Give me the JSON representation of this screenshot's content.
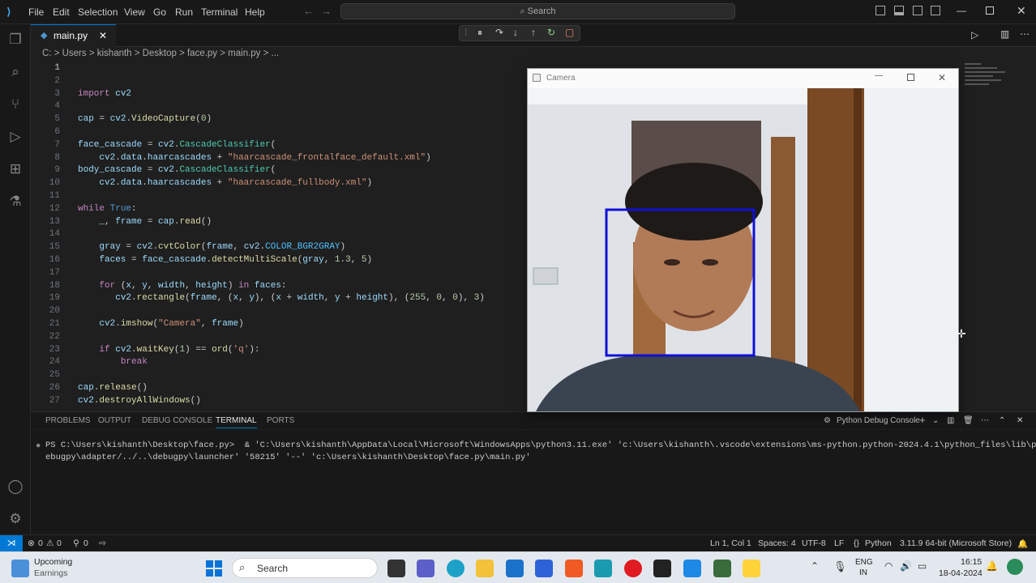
{
  "menu": [
    "File",
    "Edit",
    "Selection",
    "View",
    "Go",
    "Run",
    "Terminal",
    "Help"
  ],
  "search": {
    "label": "Search"
  },
  "tab": {
    "filename": "main.py"
  },
  "breadcrumb": "C: > Users > kishanth > Desktop > face.py > main.py > ...",
  "code": [
    {
      "n": "1",
      "t": ""
    },
    {
      "n": "2",
      "t": ""
    },
    {
      "n": "3",
      "t": "import cv2"
    },
    {
      "n": "4",
      "t": ""
    },
    {
      "n": "5",
      "t": "cap = cv2.VideoCapture(0)"
    },
    {
      "n": "6",
      "t": ""
    },
    {
      "n": "7",
      "t": "face_cascade = cv2.CascadeClassifier("
    },
    {
      "n": "8",
      "t": "    cv2.data.haarcascades + \"haarcascade_frontalface_default.xml\")"
    },
    {
      "n": "9",
      "t": "body_cascade = cv2.CascadeClassifier("
    },
    {
      "n": "10",
      "t": "    cv2.data.haarcascades + \"haarcascade_fullbody.xml\")"
    },
    {
      "n": "11",
      "t": ""
    },
    {
      "n": "12",
      "t": "while True:"
    },
    {
      "n": "13",
      "t": "    _, frame = cap.read()"
    },
    {
      "n": "14",
      "t": ""
    },
    {
      "n": "15",
      "t": "    gray = cv2.cvtColor(frame, cv2.COLOR_BGR2GRAY)"
    },
    {
      "n": "16",
      "t": "    faces = face_cascade.detectMultiScale(gray, 1.3, 5)"
    },
    {
      "n": "17",
      "t": ""
    },
    {
      "n": "18",
      "t": "    for (x, y, width, height) in faces:"
    },
    {
      "n": "19",
      "t": "       cv2.rectangle(frame, (x, y), (x + width, y + height), (255, 0, 0), 3)"
    },
    {
      "n": "20",
      "t": ""
    },
    {
      "n": "21",
      "t": "    cv2.imshow(\"Camera\", frame)"
    },
    {
      "n": "22",
      "t": ""
    },
    {
      "n": "23",
      "t": "    if cv2.waitKey(1) == ord('q'):"
    },
    {
      "n": "24",
      "t": "        break"
    },
    {
      "n": "25",
      "t": ""
    },
    {
      "n": "26",
      "t": "cap.release()"
    },
    {
      "n": "27",
      "t": "cv2.destroyAllWindows()"
    }
  ],
  "panel": {
    "tabs": [
      "PROBLEMS",
      "OUTPUT",
      "DEBUG CONSOLE",
      "TERMINAL",
      "PORTS"
    ],
    "active_tab": "TERMINAL",
    "debug_console_label": "Python Debug Console"
  },
  "terminal": {
    "line1": "PS C:\\Users\\kishanth\\Desktop\\face.py>  & 'C:\\Users\\kishanth\\AppData\\Local\\Microsoft\\WindowsApps\\python3.11.exe' 'c:\\Users\\kishanth\\.vscode\\extensions\\ms-python.python-2024.4.1\\python_files\\lib\\python\\d",
    "line2": "ebugpy\\adapter/../..\\debugpy\\launcher' '58215' '--' 'c:\\Users\\kishanth\\Desktop\\face.py\\main.py'"
  },
  "status": {
    "errors": "0",
    "warnings": "0",
    "ports": "0",
    "position": "Ln 1, Col 1",
    "spaces": "Spaces: 4",
    "encoding": "UTF-8",
    "eol": "LF",
    "language": "Python",
    "interpreter": "3.11.9 64-bit (Microsoft Store)"
  },
  "camera_window": {
    "title": "Camera"
  },
  "taskbar": {
    "weather_title": "Upcoming",
    "weather_sub": "Earnings",
    "search_label": "Search",
    "lang1": "ENG",
    "lang2": "IN",
    "time": "16:15",
    "date": "18-04-2024"
  },
  "colors": {
    "accent": "#0078d4",
    "face_box": "#1010d8"
  }
}
